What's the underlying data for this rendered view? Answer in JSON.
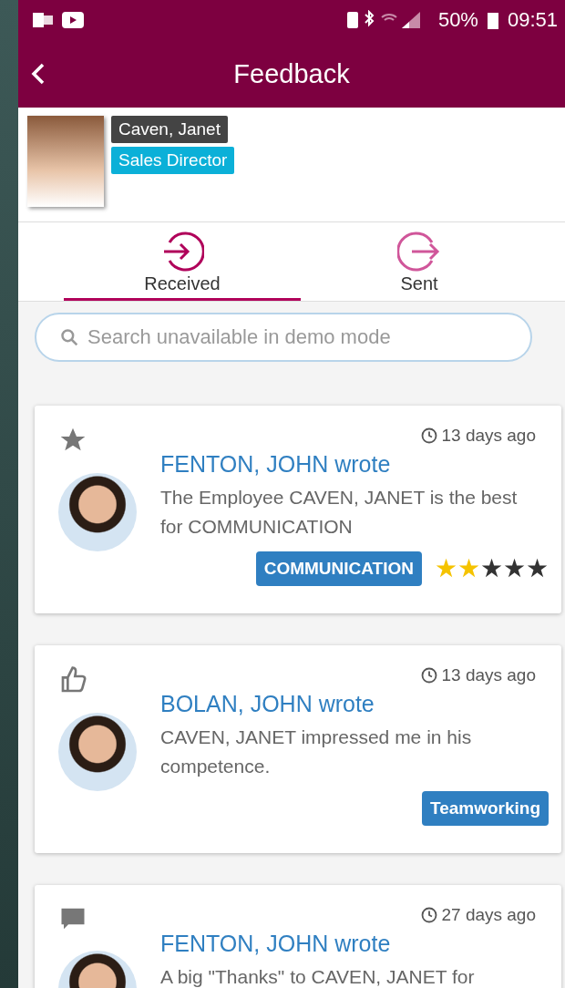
{
  "status_bar": {
    "battery": "50%",
    "time": "09:51"
  },
  "header": {
    "title": "Feedback"
  },
  "profile": {
    "name": "Caven, Janet",
    "role": "Sales Director"
  },
  "tabs": [
    {
      "label": "Received",
      "kind": "in",
      "selected": true
    },
    {
      "label": "Sent",
      "kind": "out",
      "selected": false
    }
  ],
  "search": {
    "placeholder": "Search unavailable in demo mode"
  },
  "feedback": [
    {
      "kind": "star",
      "time": "13 days ago",
      "author": "FENTON, JOHN wrote",
      "text": "The Employee CAVEN, JANET is the best for COMMUNICATION",
      "tag": "COMMUNICATION",
      "stars": 2
    },
    {
      "kind": "like",
      "time": "13 days ago",
      "author": "BOLAN, JOHN wrote",
      "text": "CAVEN, JANET impressed me in his competence.",
      "tag": "Teamworking"
    },
    {
      "kind": "quote",
      "time": "27 days ago",
      "author": "FENTON, JOHN wrote",
      "text": "A big \"Thanks\" to CAVEN, JANET for"
    }
  ]
}
